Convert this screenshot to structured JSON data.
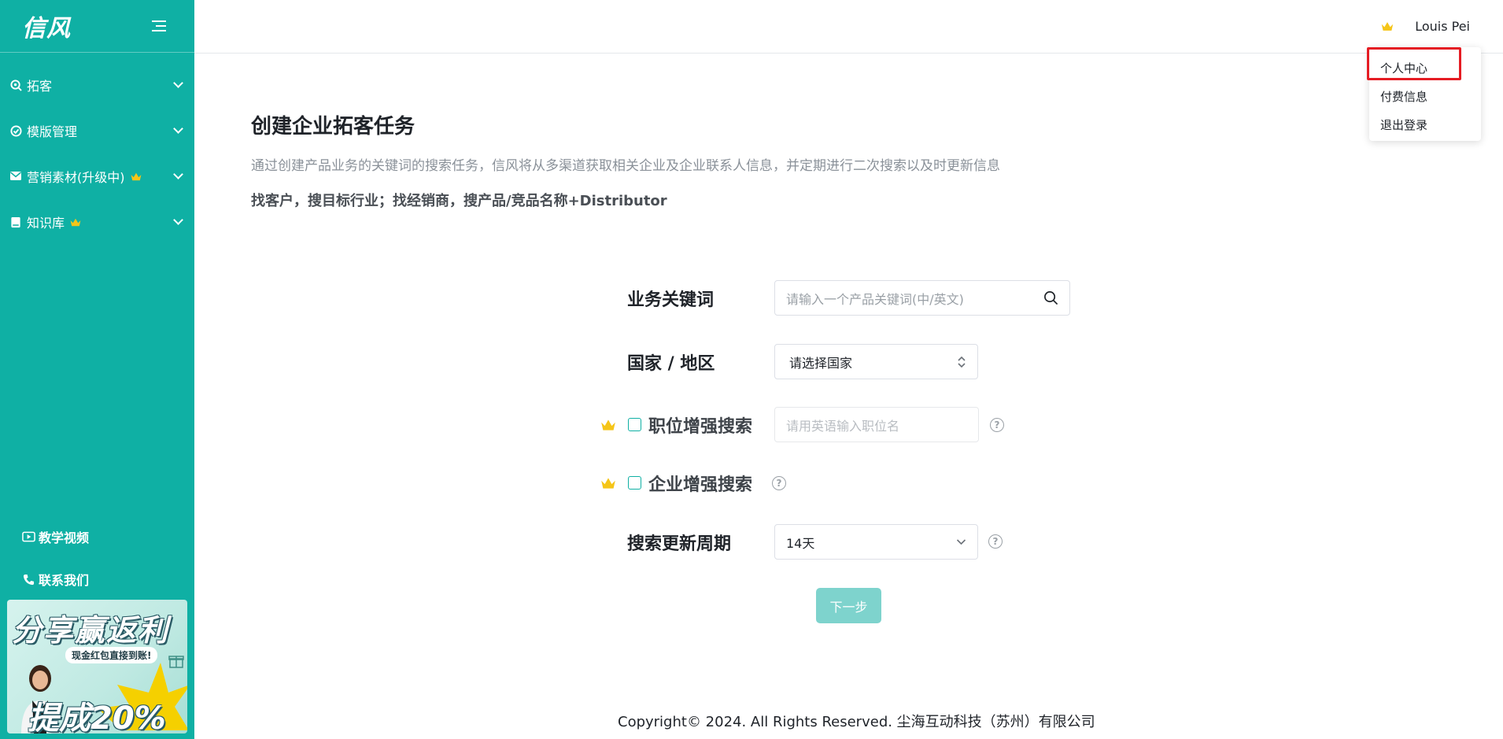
{
  "app": {
    "logo": "信风"
  },
  "sidebar": {
    "items": [
      {
        "label": "拓客",
        "icon": "search-target-icon",
        "vip": false
      },
      {
        "label": "模版管理",
        "icon": "check-circle-icon",
        "vip": false
      },
      {
        "label": "营销素材(升级中)",
        "icon": "mail-icon",
        "vip": true
      },
      {
        "label": "知识库",
        "icon": "book-icon",
        "vip": true
      }
    ],
    "bottom_links": [
      {
        "label": "教学视频",
        "icon": "video-icon"
      },
      {
        "label": "联系我们",
        "icon": "phone-icon"
      }
    ],
    "promo": {
      "title": "分享赢返利",
      "subtitle": "现金红包直接到账!",
      "highlight": "提成20%"
    }
  },
  "header": {
    "user_name": "Louis Pei",
    "dropdown": [
      "个人中心",
      "付费信息",
      "退出登录"
    ]
  },
  "main": {
    "title": "创建企业拓客任务",
    "description": "通过创建产品业务的关键词的搜索任务，信风将从多渠道获取相关企业及企业联系人信息，并定期进行二次搜索以及时更新信息",
    "hint": "找客户，搜目标行业；找经销商，搜产品/竞品名称+Distributor"
  },
  "form": {
    "keyword_label": "业务关键词",
    "keyword_placeholder": "请输入一个产品关键词(中/英文)",
    "country_label": "国家 / 地区",
    "country_placeholder": "请选择国家",
    "position_label": "职位增强搜索",
    "position_placeholder": "请用英语输入职位名",
    "company_label": "企业增强搜索",
    "cycle_label": "搜索更新周期",
    "cycle_value": "14天",
    "next_button": "下一步"
  },
  "footer": {
    "copyright": "Copyright© 2024. All Rights Reserved. 尘海互动科技（苏州）有限公司"
  },
  "colors": {
    "brand": "#0fb0a4",
    "crown": "#f5c518",
    "highlight_box": "#e51c23",
    "button_disabled": "#7ed3cd"
  }
}
